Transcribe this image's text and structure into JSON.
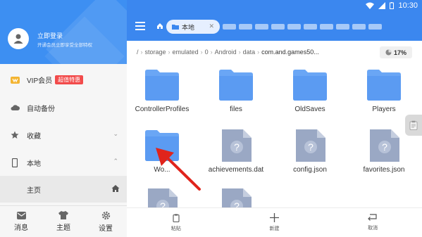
{
  "status_bar": {
    "time": "10:30"
  },
  "sidebar": {
    "profile": {
      "title": "立即登录",
      "subtitle": "开通会员立即享受全部特权"
    },
    "items": [
      {
        "label": "VIP会员",
        "badge": "超值特惠",
        "icon": "vip-crown-icon"
      },
      {
        "label": "自动备份",
        "icon": "cloud-icon"
      },
      {
        "label": "收藏",
        "icon": "star-icon"
      },
      {
        "label": "本地",
        "icon": "phone-icon"
      }
    ],
    "sub_item": {
      "label": "主页",
      "icon": "home-icon"
    },
    "bottom": [
      {
        "label": "消息",
        "icon": "message-icon"
      },
      {
        "label": "主题",
        "icon": "shirt-icon"
      },
      {
        "label": "设置",
        "icon": "gear-icon"
      }
    ]
  },
  "topbar": {
    "tab_label": "本地"
  },
  "breadcrumb": {
    "segments": [
      "/",
      "storage",
      "emulated",
      "0",
      "Android",
      "data",
      "com.and.games50..."
    ],
    "storage_percent": "17%"
  },
  "files": [
    {
      "name": "ControllerProfiles",
      "type": "folder"
    },
    {
      "name": "files",
      "type": "folder"
    },
    {
      "name": "OldSaves",
      "type": "folder"
    },
    {
      "name": "Players",
      "type": "folder"
    },
    {
      "name": "Wo...",
      "type": "folder"
    },
    {
      "name": "achievements.dat",
      "type": "unknown"
    },
    {
      "name": "config.json",
      "type": "unknown"
    },
    {
      "name": "favorites.json",
      "type": "unknown"
    },
    {
      "name": "",
      "type": "unknown"
    },
    {
      "name": "",
      "type": "unknown"
    }
  ],
  "bottom_actions": [
    {
      "label": "粘贴",
      "icon": "paste-icon"
    },
    {
      "label": "新建",
      "icon": "plus-icon"
    },
    {
      "label": "取消",
      "icon": "cancel-icon"
    }
  ],
  "colors": {
    "accent": "#3b87ef",
    "folder": "#6aa6f5",
    "unknown_file": "#9aa8c4",
    "badge": "#f24b4b",
    "arrow": "#e0241c"
  }
}
